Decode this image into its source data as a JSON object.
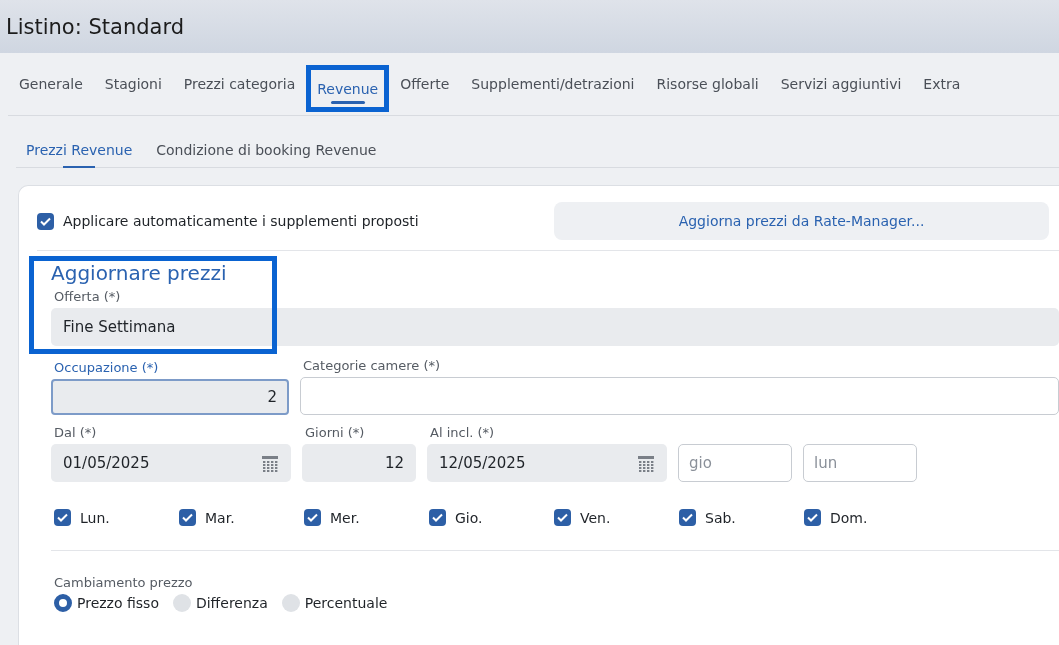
{
  "window": {
    "title": "Listino: Standard"
  },
  "tabs": [
    {
      "label": "Generale",
      "selected": false,
      "highlighted": false
    },
    {
      "label": "Stagioni",
      "selected": false,
      "highlighted": false
    },
    {
      "label": "Prezzi categoria",
      "selected": false,
      "highlighted": false
    },
    {
      "label": "Revenue",
      "selected": true,
      "highlighted": true
    },
    {
      "label": "Offerte",
      "selected": false,
      "highlighted": false
    },
    {
      "label": "Supplementi/detrazioni",
      "selected": false,
      "highlighted": false
    },
    {
      "label": "Risorse globali",
      "selected": false,
      "highlighted": false
    },
    {
      "label": "Servizi aggiuntivi",
      "selected": false,
      "highlighted": false
    },
    {
      "label": "Extra",
      "selected": false,
      "highlighted": false
    }
  ],
  "subtabs": [
    {
      "label": "Prezzi Revenue",
      "selected": true
    },
    {
      "label": "Condizione di booking Revenue",
      "selected": false
    }
  ],
  "auto_supplements": {
    "label": "Applicare automaticamente i supplementi proposti",
    "checked": true
  },
  "rate_manager_button": "Aggiorna prezzi da Rate-Manager...",
  "section": {
    "title": "Aggiornare prezzi",
    "highlighted": true,
    "offer": {
      "label": "Offerta (*)",
      "value": "Fine Settimana"
    }
  },
  "occupancy": {
    "label": "Occupazione (*)",
    "value": "2",
    "focused": true
  },
  "room_categories": {
    "label": "Categorie camere (*)"
  },
  "from": {
    "label": "Dal (*)",
    "value": "01/05/2025"
  },
  "days": {
    "label": "Giorni (*)",
    "value": "12"
  },
  "to": {
    "label": "Al incl. (*)",
    "value": "12/05/2025"
  },
  "from_weekday": {
    "placeholder": "gio"
  },
  "to_weekday": {
    "placeholder": "lun"
  },
  "weekdays": [
    {
      "label": "Lun.",
      "checked": true
    },
    {
      "label": "Mar.",
      "checked": true
    },
    {
      "label": "Mer.",
      "checked": true
    },
    {
      "label": "Gio.",
      "checked": true
    },
    {
      "label": "Ven.",
      "checked": true
    },
    {
      "label": "Sab.",
      "checked": true
    },
    {
      "label": "Dom.",
      "checked": true
    }
  ],
  "price_change": {
    "label": "Cambiamento prezzo",
    "options": [
      {
        "label": "Prezzo fisso",
        "selected": true
      },
      {
        "label": "Differenza",
        "selected": false
      },
      {
        "label": "Percentuale",
        "selected": false
      }
    ]
  }
}
